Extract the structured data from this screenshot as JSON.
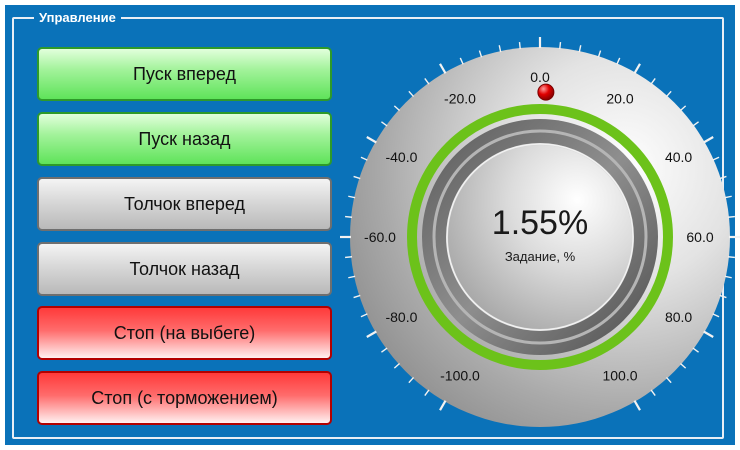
{
  "group": {
    "title": "Управление"
  },
  "buttons": [
    {
      "label": "Пуск вперед",
      "style": "green"
    },
    {
      "label": "Пуск назад",
      "style": "green"
    },
    {
      "label": "Толчок вперед",
      "style": "gray"
    },
    {
      "label": "Толчок назад",
      "style": "gray"
    },
    {
      "label": "Стоп (на выбеге)",
      "style": "red"
    },
    {
      "label": "Стоп (с торможением)",
      "style": "red"
    }
  ],
  "dial": {
    "value_text": "1.55%",
    "caption": "Задание, %",
    "value": 1.55,
    "scale_min": -100,
    "scale_max": 100,
    "scale_labels": [
      "-100.0",
      "-80.0",
      "-60.0",
      "-40.0",
      "-20.0",
      "0.0",
      "20.0",
      "40.0",
      "60.0",
      "80.0",
      "100.0"
    ],
    "indicator_color": "#e00000",
    "ring_color": "#6cc21a"
  }
}
